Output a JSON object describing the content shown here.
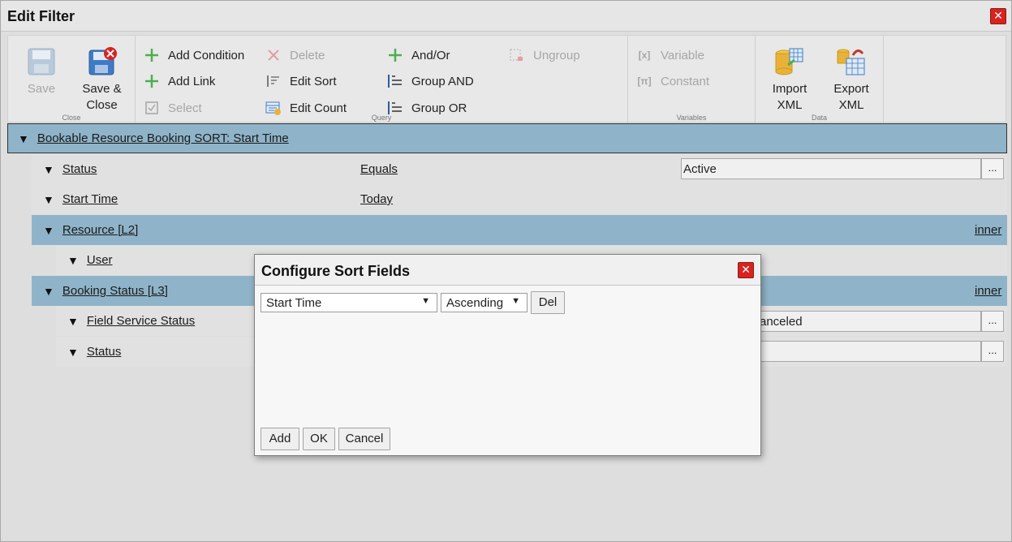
{
  "window": {
    "title": "Edit Filter"
  },
  "ribbon": {
    "close_group": {
      "label": "Close",
      "save": "Save",
      "save_close_1": "Save &",
      "save_close_2": "Close"
    },
    "query_group": {
      "label": "Query",
      "add_condition": "Add Condition",
      "add_link": "Add Link",
      "select": "Select",
      "delete": "Delete",
      "edit_sort": "Edit Sort",
      "edit_count": "Edit Count",
      "and_or": "And/Or",
      "group_and": "Group AND",
      "group_or": "Group OR",
      "ungroup": "Ungroup"
    },
    "variables_group": {
      "label": "Variables",
      "variable": "Variable",
      "constant": "Constant"
    },
    "data_group": {
      "label": "Data",
      "import_1": "Import",
      "import_2": "XML",
      "export_1": "Export",
      "export_2": "XML"
    }
  },
  "tree": {
    "root": "Bookable Resource Booking SORT: Start Time",
    "status_field": "Status",
    "status_op": "Equals",
    "status_value": "Active",
    "start_time_field": "Start Time",
    "start_time_op": "Today",
    "resource_link": "Resource [L2]",
    "resource_join": "inner",
    "user_field": "User",
    "booking_status_link": "Booking Status [L3]",
    "booking_status_join": "inner",
    "fss_field": "Field Service Status",
    "fss_value": "anceled",
    "status2_field": "Status",
    "dots": "..."
  },
  "dialog": {
    "title": "Configure Sort Fields",
    "sort_field": "Start Time",
    "sort_order": "Ascending",
    "del": "Del",
    "add": "Add",
    "ok": "OK",
    "cancel": "Cancel"
  },
  "colors": {
    "entity_row": "#8fb4c9",
    "close_red": "#d8231f",
    "add_green": "#4caf50"
  }
}
